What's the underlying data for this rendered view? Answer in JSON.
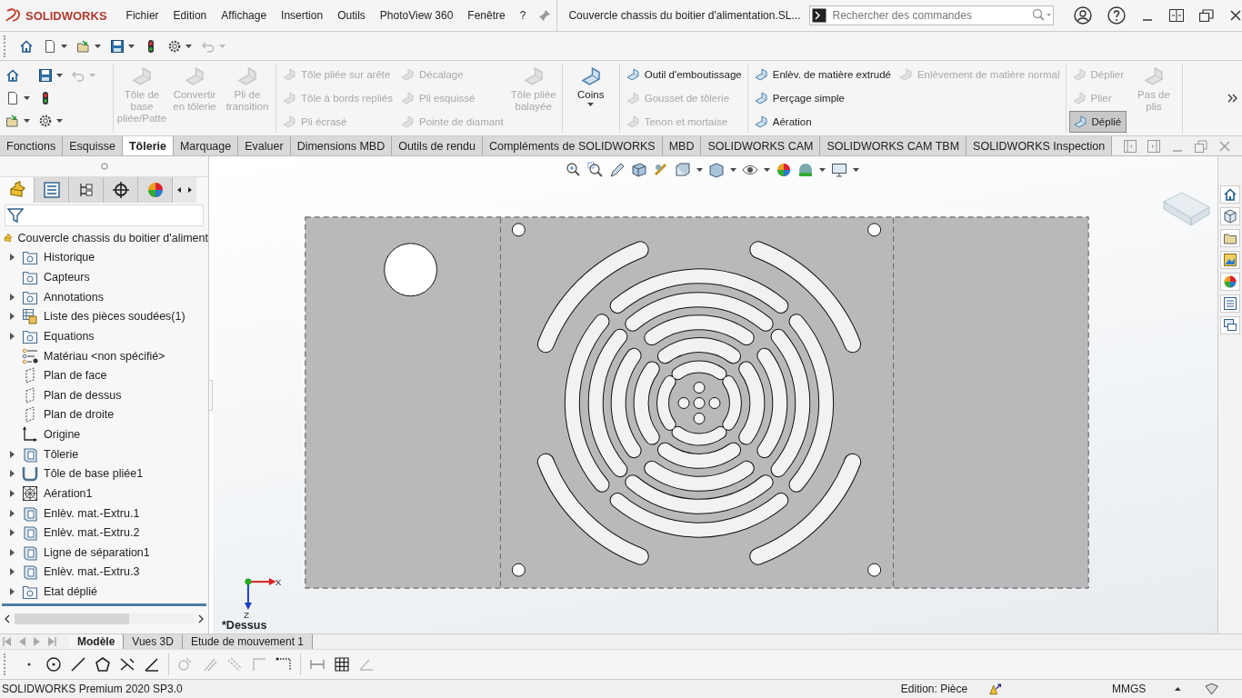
{
  "app": {
    "logo": "SOLIDWORKS"
  },
  "menu": [
    {
      "label": "Fichier"
    },
    {
      "label": "Edition"
    },
    {
      "label": "Affichage"
    },
    {
      "label": "Insertion"
    },
    {
      "label": "Outils"
    },
    {
      "label": "PhotoView 360"
    },
    {
      "label": "Fenêtre"
    },
    {
      "label": "?"
    }
  ],
  "document_title": "Couvercle chassis du boitier d'alimentation.SL...",
  "search": {
    "placeholder": "Rechercher des commandes"
  },
  "ribbon": {
    "groups": [
      {
        "columns": [
          {
            "kind": "large",
            "dropdown": false,
            "commands": [
              {
                "label": "Tôle de base pliée/Patte",
                "disabled": true,
                "selected": false
              }
            ]
          },
          {
            "kind": "large",
            "dropdown": false,
            "commands": [
              {
                "label": "Convertir en tôlerie",
                "disabled": true,
                "selected": false
              }
            ]
          },
          {
            "kind": "large",
            "dropdown": false,
            "commands": [
              {
                "label": "Pli de transition",
                "disabled": true,
                "selected": false
              }
            ]
          }
        ]
      },
      {
        "columns": [
          {
            "kind": "stack",
            "commands": [
              {
                "label": "Tôle pliée sur arête",
                "disabled": true,
                "selected": false
              },
              {
                "label": "Tôle à bords repliés",
                "disabled": true,
                "selected": false
              },
              {
                "label": "Pli écrasé",
                "disabled": true,
                "selected": false
              }
            ]
          },
          {
            "kind": "stack",
            "commands": [
              {
                "label": "Décalage",
                "disabled": true,
                "selected": false
              },
              {
                "label": "Pli esquissé",
                "disabled": true,
                "selected": false
              },
              {
                "label": "Pointe de diamant",
                "disabled": true,
                "selected": false
              }
            ]
          },
          {
            "kind": "large",
            "dropdown": false,
            "commands": [
              {
                "label": "Tôle pliée balayée",
                "disabled": true,
                "selected": false
              }
            ]
          }
        ]
      },
      {
        "columns": [
          {
            "kind": "large",
            "dropdown": true,
            "commands": [
              {
                "label": "Coins",
                "disabled": false,
                "selected": false
              }
            ]
          }
        ]
      },
      {
        "columns": [
          {
            "kind": "stack",
            "commands": [
              {
                "label": "Outil d'emboutissage",
                "disabled": false,
                "selected": false
              },
              {
                "label": "Gousset de tôlerie",
                "disabled": true,
                "selected": false
              },
              {
                "label": "Tenon et mortaise",
                "disabled": true,
                "selected": false
              }
            ]
          }
        ]
      },
      {
        "columns": [
          {
            "kind": "stack",
            "commands": [
              {
                "label": "Enlèv. de matière extrudé",
                "disabled": false,
                "selected": false
              },
              {
                "label": "Perçage simple",
                "disabled": false,
                "selected": false
              },
              {
                "label": "Aération",
                "disabled": false,
                "selected": false
              }
            ]
          },
          {
            "kind": "stack",
            "commands": [
              {
                "label": "Enlèvement de matière normal",
                "disabled": true,
                "selected": false
              }
            ]
          }
        ]
      },
      {
        "columns": [
          {
            "kind": "stack",
            "commands": [
              {
                "label": "Déplier",
                "disabled": true,
                "selected": false
              },
              {
                "label": "Plier",
                "disabled": true,
                "selected": false
              },
              {
                "label": "Déplié",
                "disabled": false,
                "selected": true
              }
            ]
          },
          {
            "kind": "large",
            "dropdown": false,
            "commands": [
              {
                "label": "Pas de plis",
                "disabled": true,
                "selected": false
              }
            ]
          }
        ]
      }
    ]
  },
  "command_tabs": [
    {
      "label": "Fonctions",
      "selected": false
    },
    {
      "label": "Esquisse",
      "selected": false
    },
    {
      "label": "Tôlerie",
      "selected": true
    },
    {
      "label": "Marquage",
      "selected": false
    },
    {
      "label": "Evaluer",
      "selected": false
    },
    {
      "label": "Dimensions MBD",
      "selected": false
    },
    {
      "label": "Outils de rendu",
      "selected": false
    },
    {
      "label": "Compléments de SOLIDWORKS",
      "selected": false
    },
    {
      "label": "MBD",
      "selected": false
    },
    {
      "label": "SOLIDWORKS CAM",
      "selected": false
    },
    {
      "label": "SOLIDWORKS CAM TBM",
      "selected": false
    },
    {
      "label": "SOLIDWORKS Inspection",
      "selected": false
    }
  ],
  "feature_manager": {
    "tabs": [
      {
        "selected": true
      },
      {
        "selected": false
      },
      {
        "selected": false
      },
      {
        "selected": false
      },
      {
        "selected": false
      }
    ],
    "root": "Couvercle chassis du boitier d'aliment",
    "items": [
      {
        "label": "Historique",
        "kind": "folder",
        "expandable": true
      },
      {
        "label": "Capteurs",
        "kind": "folder",
        "expandable": false
      },
      {
        "label": "Annotations",
        "kind": "folder",
        "expandable": true
      },
      {
        "label": "Liste des pièces soudées(1)",
        "kind": "weldments",
        "expandable": true
      },
      {
        "label": "Equations",
        "kind": "folder",
        "expandable": true
      },
      {
        "label": "Matériau <non spécifié>",
        "kind": "material",
        "expandable": false
      },
      {
        "label": "Plan de face",
        "kind": "plane",
        "expandable": false
      },
      {
        "label": "Plan de dessus",
        "kind": "plane",
        "expandable": false
      },
      {
        "label": "Plan de droite",
        "kind": "plane",
        "expandable": false
      },
      {
        "label": "Origine",
        "kind": "origin",
        "expandable": false
      },
      {
        "label": "Tôlerie",
        "kind": "feature",
        "expandable": true
      },
      {
        "label": "Tôle de base pliée1",
        "kind": "bend",
        "expandable": true
      },
      {
        "label": "Aération1",
        "kind": "vent",
        "expandable": true
      },
      {
        "label": "Enlèv. mat.-Extru.1",
        "kind": "feature",
        "expandable": true
      },
      {
        "label": "Enlèv. mat.-Extru.2",
        "kind": "feature",
        "expandable": true
      },
      {
        "label": "Ligne de séparation1",
        "kind": "feature",
        "expandable": true
      },
      {
        "label": "Enlèv. mat.-Extru.3",
        "kind": "feature",
        "expandable": true
      },
      {
        "label": "Etat déplié",
        "kind": "folder",
        "expandable": true
      }
    ]
  },
  "viewport": {
    "view_name": "*Dessus",
    "axes": [
      "X",
      "Z"
    ]
  },
  "bottom_tabs": [
    {
      "label": "Modèle",
      "selected": true
    },
    {
      "label": "Vues 3D",
      "selected": false
    },
    {
      "label": "Etude de mouvement 1",
      "selected": false
    }
  ],
  "status_bar": {
    "product": "SOLIDWORKS Premium 2020 SP3.0",
    "mode": "Edition: Pièce",
    "units": "MMGS"
  }
}
